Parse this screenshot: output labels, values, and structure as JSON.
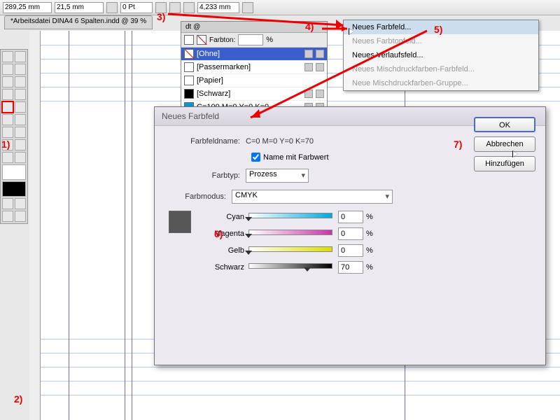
{
  "top": {
    "field1": "289,25 mm",
    "field2": "21,5 mm",
    "pt": "0 Pt",
    "mm": "4,233 mm"
  },
  "doc": {
    "tab": "*Arbeitsdatei DINA4 6 Spalten.indd @ 39 %"
  },
  "swatches": {
    "tab": "dt @",
    "tint_label": "Farbton:",
    "tint_pct": "%",
    "items": [
      {
        "name": "[Ohne]",
        "selected": true,
        "bg": "#fff"
      },
      {
        "name": "[Passermarken]",
        "bg": "#fff"
      },
      {
        "name": "[Papier]",
        "bg": "#fff"
      },
      {
        "name": "[Schwarz]",
        "bg": "#000"
      },
      {
        "name": "C=100 M=0 Y=0 K=0",
        "bg": "#00a0e0"
      }
    ]
  },
  "menu": {
    "items": [
      {
        "label": "Neues Farbfeld...",
        "active": true
      },
      {
        "label": "Neues Farbtonfeld...",
        "dis": true
      },
      {
        "label": "Neues Verlaufsfeld..."
      },
      {
        "label": "Neues Mischdruckfarben-Farbfeld...",
        "dis": true
      },
      {
        "label": "Neue Mischdruckfarben-Gruppe...",
        "dis": true
      }
    ]
  },
  "dialog": {
    "title": "Neues Farbfeld",
    "name_label": "Farbfeldname:",
    "name_value": "C=0 M=0 Y=0 K=70",
    "name_with_value": "Name mit Farbwert",
    "type_label": "Farbtyp:",
    "type_value": "Prozess",
    "mode_label": "Farbmodus:",
    "mode_value": "CMYK",
    "cyan": "Cyan",
    "magenta": "Magenta",
    "gelb": "Gelb",
    "schwarz": "Schwarz",
    "pct": "%",
    "v_c": "0",
    "v_m": "0",
    "v_y": "0",
    "v_k": "70",
    "ok": "OK",
    "cancel": "Abbrechen",
    "add": "Hinzufügen"
  },
  "annot": {
    "1": "1)",
    "2": "2)",
    "3": "3)",
    "4": "4)",
    "5": "5)",
    "6": "6)",
    "7": "7)"
  }
}
